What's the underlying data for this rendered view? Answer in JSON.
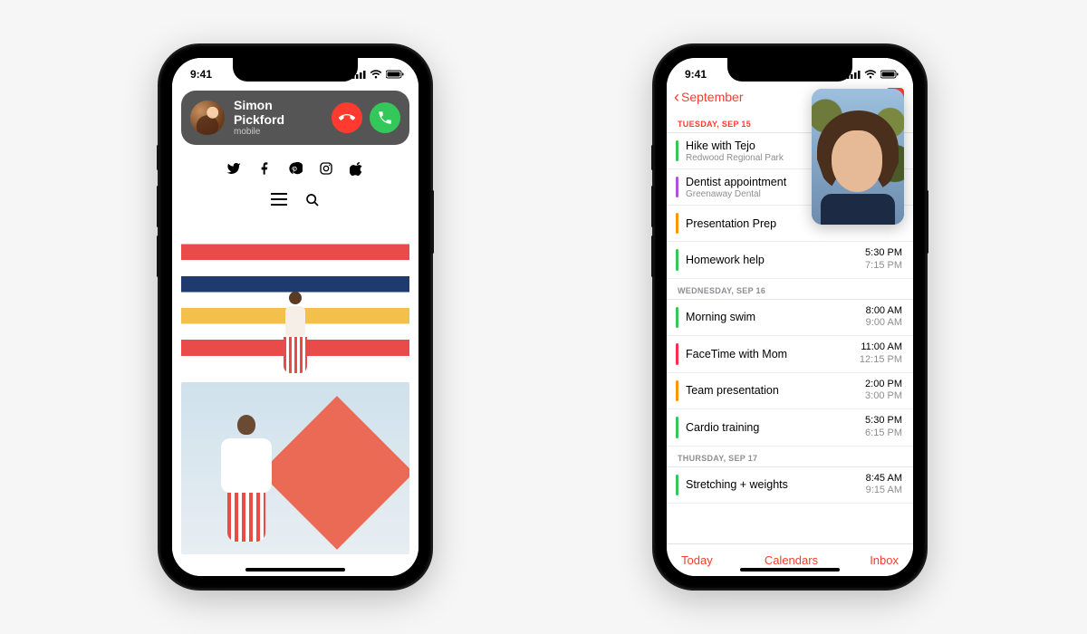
{
  "status_time": "9:41",
  "phone1": {
    "caller_name": "Simon Pickford",
    "caller_source": "mobile",
    "social_icons": [
      "twitter-icon",
      "facebook-icon",
      "pinterest-icon",
      "instagram-icon",
      "apple-icon"
    ]
  },
  "phone2": {
    "back_label": "September",
    "pip_caller": "FaceTime caller",
    "toolbar": {
      "today": "Today",
      "calendars": "Calendars",
      "inbox": "Inbox"
    },
    "sections": [
      {
        "header": "TUESDAY, SEP 15",
        "first": true,
        "events": [
          {
            "title": "Hike with Tejo",
            "sub": "Redwood Regional Park",
            "t1": "",
            "t2": "",
            "color": "#34c759"
          },
          {
            "title": "Dentist appointment",
            "sub": "Greenaway Dental",
            "t1": "",
            "t2": "",
            "color": "#af52de"
          },
          {
            "title": "Presentation Prep",
            "sub": "",
            "t1": "",
            "t2": "",
            "color": "#ff9500"
          },
          {
            "title": "Homework help",
            "sub": "",
            "t1": "5:30 PM",
            "t2": "7:15 PM",
            "color": "#34c759"
          }
        ]
      },
      {
        "header": "WEDNESDAY, SEP 16",
        "first": false,
        "events": [
          {
            "title": "Morning swim",
            "sub": "",
            "t1": "8:00 AM",
            "t2": "9:00 AM",
            "color": "#34c759"
          },
          {
            "title": "FaceTime with Mom",
            "sub": "",
            "t1": "11:00 AM",
            "t2": "12:15 PM",
            "color": "#ff2d55"
          },
          {
            "title": "Team presentation",
            "sub": "",
            "t1": "2:00 PM",
            "t2": "3:00 PM",
            "color": "#ff9500"
          },
          {
            "title": "Cardio training",
            "sub": "",
            "t1": "5:30 PM",
            "t2": "6:15 PM",
            "color": "#34c759"
          }
        ]
      },
      {
        "header": "THURSDAY, SEP 17",
        "first": false,
        "events": [
          {
            "title": "Stretching + weights",
            "sub": "",
            "t1": "8:45 AM",
            "t2": "9:15 AM",
            "color": "#34c759"
          }
        ]
      }
    ]
  }
}
